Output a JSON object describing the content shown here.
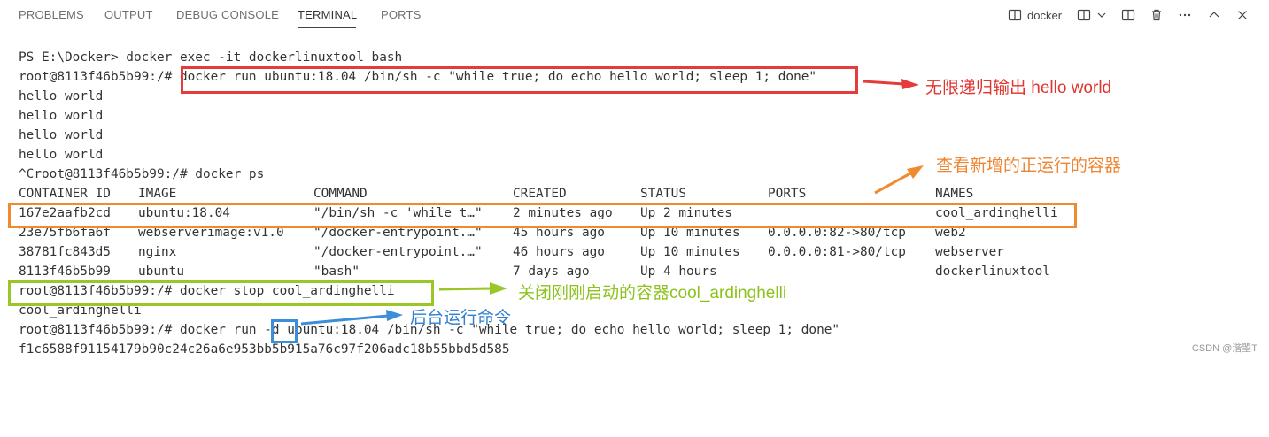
{
  "tabs": {
    "problems": "PROBLEMS",
    "output": "OUTPUT",
    "debug_console": "DEBUG CONSOLE",
    "terminal": "TERMINAL",
    "ports": "PORTS"
  },
  "toolbar": {
    "shell_label": "docker",
    "icons": [
      "terminal-icon",
      "split-terminal-icon",
      "chevron-down-icon",
      "layout-icon",
      "trash-icon",
      "more-icon",
      "chevron-up-icon",
      "close-icon"
    ]
  },
  "terminal": {
    "lines": [
      {
        "prompt": "PS E:\\Docker> ",
        "command": "docker exec -it dockerlinuxtool bash"
      },
      {
        "prompt": "root@8113f46b5b99:/# ",
        "command": "docker run ubuntu:18.04 /bin/sh -c \"while true; do echo hello world; sleep 1; done\""
      },
      {
        "prompt": "",
        "command": "hello world"
      },
      {
        "prompt": "",
        "command": "hello world"
      },
      {
        "prompt": "",
        "command": "hello world"
      },
      {
        "prompt": "",
        "command": "hello world"
      },
      {
        "prompt": "^Croot@8113f46b5b99:/# ",
        "command": "docker ps"
      }
    ],
    "ps_table": {
      "headers": [
        "CONTAINER ID",
        "IMAGE",
        "COMMAND",
        "CREATED",
        "STATUS",
        "PORTS",
        "NAMES"
      ],
      "rows": [
        [
          "167e2aafb2cd",
          "ubuntu:18.04",
          "\"/bin/sh -c 'while t…\"",
          "2 minutes ago",
          "Up 2 minutes",
          "",
          "cool_ardinghelli"
        ],
        [
          "23e75fb6fa6f",
          "webserverimage:v1.0",
          "\"/docker-entrypoint.…\"",
          "45 hours ago",
          "Up 10 minutes",
          "0.0.0.0:82->80/tcp",
          "web2"
        ],
        [
          "38781fc843d5",
          "nginx",
          "\"/docker-entrypoint.…\"",
          "46 hours ago",
          "Up 10 minutes",
          "0.0.0.0:81->80/tcp",
          "webserver"
        ],
        [
          "8113f46b5b99",
          "ubuntu",
          "\"bash\"",
          "7 days ago",
          "Up 4 hours",
          "",
          "dockerlinuxtool"
        ]
      ]
    },
    "after": [
      {
        "prompt": "root@8113f46b5b99:/# ",
        "command": "docker stop cool_ardinghelli"
      },
      {
        "prompt": "",
        "command": "cool_ardinghelli"
      },
      {
        "prompt": "root@8113f46b5b99:/# ",
        "command": "docker run ",
        "flag": "-d",
        "rest": " ubuntu:18.04 /bin/sh -c \"while true; do echo hello world; sleep 1; done\""
      },
      {
        "prompt": "",
        "command": "f1c6588f91154179b90c24c26a6e953bb5b915a76c97f206adc18b55bbd5d585"
      }
    ]
  },
  "annotations": {
    "infinite_output": "无限递归输出 hello world",
    "view_new_running": "查看新增的正运行的容器",
    "stop_container": "关闭刚刚启动的容器cool_ardinghelli",
    "background_flag": "后台运行命令"
  },
  "colors": {
    "red": "#e63b3b",
    "orange": "#f08a30",
    "green": "#9ac628",
    "blue": "#3c8ed8"
  },
  "watermark": "CSDN @湝曌T"
}
